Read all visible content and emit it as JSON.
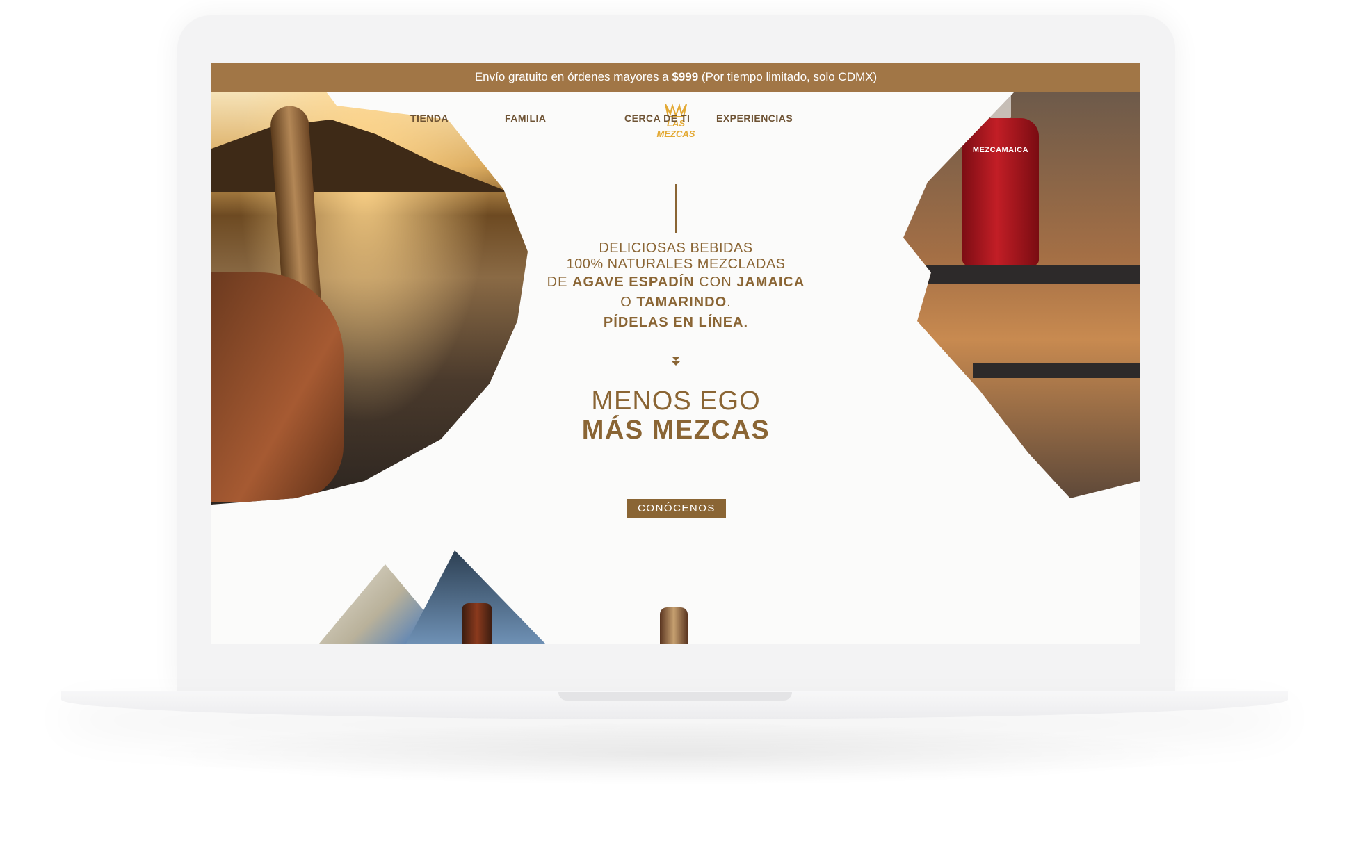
{
  "promo": {
    "prefix": "Envío gratuito en órdenes mayores a ",
    "amount": "$999",
    "suffix": " (Por tiempo limitado, solo CDMX)"
  },
  "nav": {
    "items": [
      "TIENDA",
      "FAMILIA",
      "CERCA DE TI",
      "EXPERIENCIAS"
    ],
    "logo_line1": "LAS",
    "logo_line2": "MEZCAS"
  },
  "hero": {
    "line1": "DELICIOSAS BEBIDAS",
    "line2": "100% NATURALES MEZCLADAS",
    "line3_a": "DE ",
    "line3_b": "AGAVE ESPADÍN",
    "line3_c": " CON ",
    "line3_d": "JAMAICA",
    "line4_a": "O ",
    "line4_b": "TAMARINDO",
    "line4_c": ".",
    "line5": "PÍDELAS EN LÍNEA.",
    "tagline1": "MENOS EGO",
    "tagline2": "MÁS MEZCAS",
    "cta_label": "CONÓCENOS"
  },
  "product": {
    "bottle_label": "MEZCAMAICA"
  },
  "colors": {
    "brand_brown": "#8a6534",
    "promo_bar": "#a17646",
    "logo_gold": "#e3a934"
  },
  "icons": {
    "logo": "crown-agave-icon",
    "scroll": "double-chevron-down-icon"
  }
}
